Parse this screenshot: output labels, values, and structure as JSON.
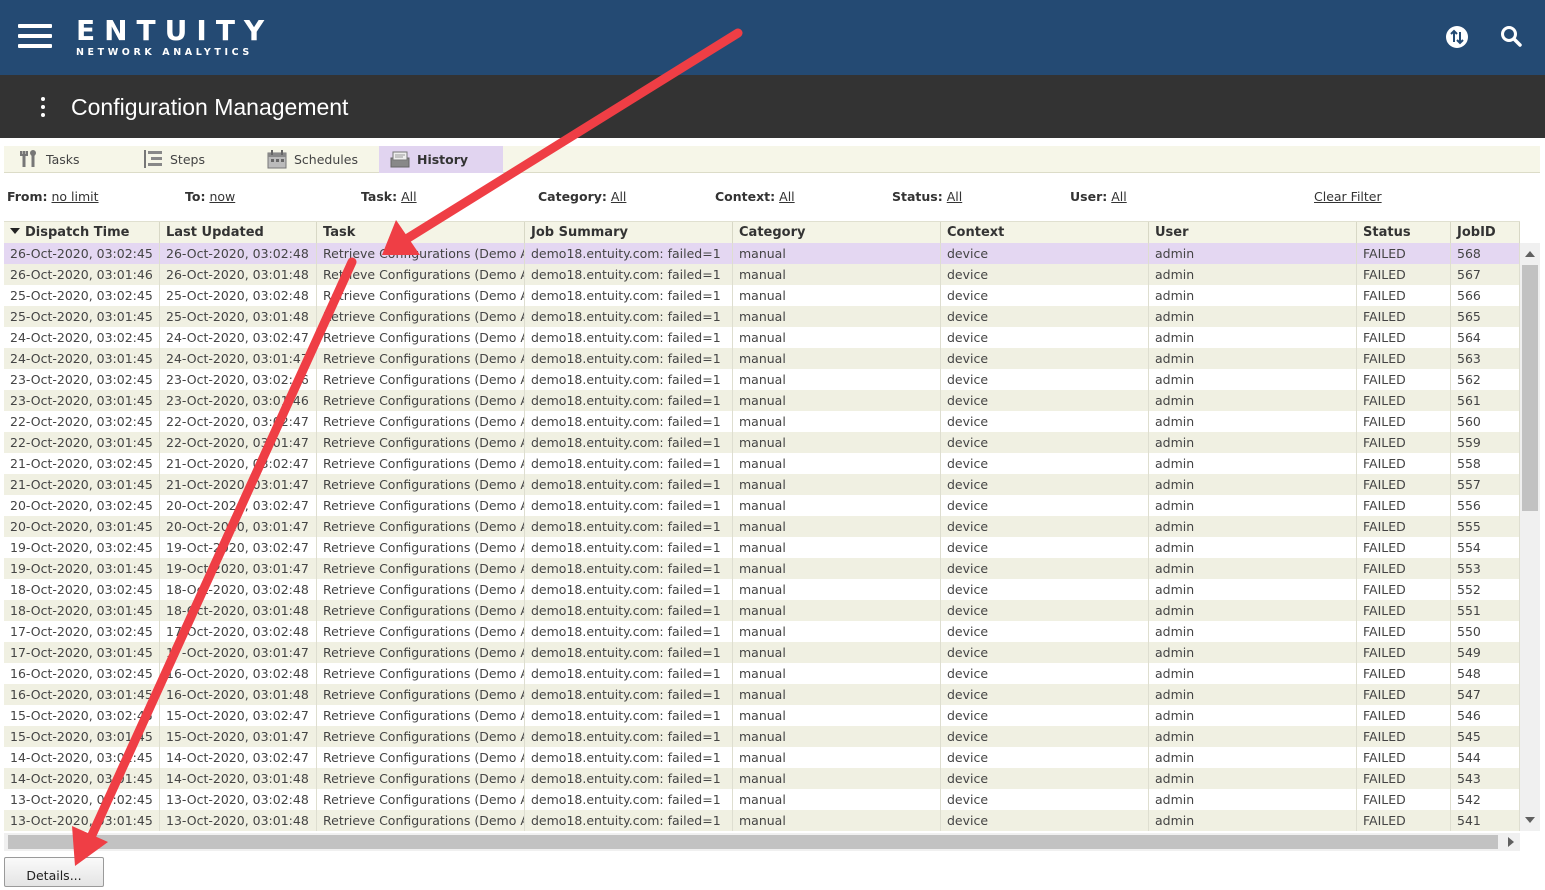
{
  "app": {
    "logo_main": "ENTUITY",
    "logo_sub": "NETWORK ANALYTICS",
    "page_title": "Configuration Management"
  },
  "icons": {
    "menu": "hamburger-menu-icon",
    "sync": "sync-icon",
    "search": "search-icon",
    "more": "kebab-menu-icon"
  },
  "colors": {
    "header": "#244a73",
    "titlebar": "#333333",
    "tab_active": "#e1d4f0",
    "row_selected": "#e4d7f2",
    "row_alt": "#f0f0e2",
    "annotation_arrow": "#ef3e45"
  },
  "tabs": [
    {
      "label": "Tasks",
      "icon": "tools-icon",
      "active": false
    },
    {
      "label": "Steps",
      "icon": "steps-icon",
      "active": false
    },
    {
      "label": "Schedules",
      "icon": "schedule-icon",
      "active": false
    },
    {
      "label": "History",
      "icon": "history-icon",
      "active": true
    }
  ],
  "filters": [
    {
      "label": "From:",
      "value": "no limit"
    },
    {
      "label": "To:",
      "value": "now"
    },
    {
      "label": "Task:",
      "value": "All"
    },
    {
      "label": "Category:",
      "value": "All"
    },
    {
      "label": "Context:",
      "value": "All"
    },
    {
      "label": "Status:",
      "value": "All"
    },
    {
      "label": "User:",
      "value": "All"
    }
  ],
  "clear_filter": "Clear Filter",
  "table": {
    "sorted_column": "Dispatch Time",
    "columns": [
      "Dispatch Time",
      "Last Updated",
      "Task",
      "Job Summary",
      "Category",
      "Context",
      "User",
      "Status",
      "JobID"
    ],
    "rows": [
      [
        "26-Oct-2020, 03:02:45",
        "26-Oct-2020, 03:02:48",
        "Retrieve Configurations (Demo Ap",
        "demo18.entuity.com: failed=1",
        "manual",
        "device",
        "admin",
        "FAILED",
        "568"
      ],
      [
        "26-Oct-2020, 03:01:46",
        "26-Oct-2020, 03:01:48",
        "Retrieve Configurations (Demo Ap",
        "demo18.entuity.com: failed=1",
        "manual",
        "device",
        "admin",
        "FAILED",
        "567"
      ],
      [
        "25-Oct-2020, 03:02:45",
        "25-Oct-2020, 03:02:48",
        "Retrieve Configurations (Demo Ap",
        "demo18.entuity.com: failed=1",
        "manual",
        "device",
        "admin",
        "FAILED",
        "566"
      ],
      [
        "25-Oct-2020, 03:01:45",
        "25-Oct-2020, 03:01:48",
        "Retrieve Configurations (Demo Ap",
        "demo18.entuity.com: failed=1",
        "manual",
        "device",
        "admin",
        "FAILED",
        "565"
      ],
      [
        "24-Oct-2020, 03:02:45",
        "24-Oct-2020, 03:02:47",
        "Retrieve Configurations (Demo Ap",
        "demo18.entuity.com: failed=1",
        "manual",
        "device",
        "admin",
        "FAILED",
        "564"
      ],
      [
        "24-Oct-2020, 03:01:45",
        "24-Oct-2020, 03:01:47",
        "Retrieve Configurations (Demo Ap",
        "demo18.entuity.com: failed=1",
        "manual",
        "device",
        "admin",
        "FAILED",
        "563"
      ],
      [
        "23-Oct-2020, 03:02:45",
        "23-Oct-2020, 03:02:46",
        "Retrieve Configurations (Demo Ap",
        "demo18.entuity.com: failed=1",
        "manual",
        "device",
        "admin",
        "FAILED",
        "562"
      ],
      [
        "23-Oct-2020, 03:01:45",
        "23-Oct-2020, 03:01:46",
        "Retrieve Configurations (Demo Ap",
        "demo18.entuity.com: failed=1",
        "manual",
        "device",
        "admin",
        "FAILED",
        "561"
      ],
      [
        "22-Oct-2020, 03:02:45",
        "22-Oct-2020, 03:02:47",
        "Retrieve Configurations (Demo Ap",
        "demo18.entuity.com: failed=1",
        "manual",
        "device",
        "admin",
        "FAILED",
        "560"
      ],
      [
        "22-Oct-2020, 03:01:45",
        "22-Oct-2020, 03:01:47",
        "Retrieve Configurations (Demo Ap",
        "demo18.entuity.com: failed=1",
        "manual",
        "device",
        "admin",
        "FAILED",
        "559"
      ],
      [
        "21-Oct-2020, 03:02:45",
        "21-Oct-2020, 03:02:47",
        "Retrieve Configurations (Demo Ap",
        "demo18.entuity.com: failed=1",
        "manual",
        "device",
        "admin",
        "FAILED",
        "558"
      ],
      [
        "21-Oct-2020, 03:01:45",
        "21-Oct-2020, 03:01:47",
        "Retrieve Configurations (Demo Ap",
        "demo18.entuity.com: failed=1",
        "manual",
        "device",
        "admin",
        "FAILED",
        "557"
      ],
      [
        "20-Oct-2020, 03:02:45",
        "20-Oct-2020, 03:02:47",
        "Retrieve Configurations (Demo Ap",
        "demo18.entuity.com: failed=1",
        "manual",
        "device",
        "admin",
        "FAILED",
        "556"
      ],
      [
        "20-Oct-2020, 03:01:45",
        "20-Oct-2020, 03:01:47",
        "Retrieve Configurations (Demo Ap",
        "demo18.entuity.com: failed=1",
        "manual",
        "device",
        "admin",
        "FAILED",
        "555"
      ],
      [
        "19-Oct-2020, 03:02:45",
        "19-Oct-2020, 03:02:47",
        "Retrieve Configurations (Demo Ap",
        "demo18.entuity.com: failed=1",
        "manual",
        "device",
        "admin",
        "FAILED",
        "554"
      ],
      [
        "19-Oct-2020, 03:01:45",
        "19-Oct-2020, 03:01:47",
        "Retrieve Configurations (Demo Ap",
        "demo18.entuity.com: failed=1",
        "manual",
        "device",
        "admin",
        "FAILED",
        "553"
      ],
      [
        "18-Oct-2020, 03:02:45",
        "18-Oct-2020, 03:02:48",
        "Retrieve Configurations (Demo Ap",
        "demo18.entuity.com: failed=1",
        "manual",
        "device",
        "admin",
        "FAILED",
        "552"
      ],
      [
        "18-Oct-2020, 03:01:45",
        "18-Oct-2020, 03:01:48",
        "Retrieve Configurations (Demo Ap",
        "demo18.entuity.com: failed=1",
        "manual",
        "device",
        "admin",
        "FAILED",
        "551"
      ],
      [
        "17-Oct-2020, 03:02:45",
        "17-Oct-2020, 03:02:48",
        "Retrieve Configurations (Demo Ap",
        "demo18.entuity.com: failed=1",
        "manual",
        "device",
        "admin",
        "FAILED",
        "550"
      ],
      [
        "17-Oct-2020, 03:01:45",
        "17-Oct-2020, 03:01:47",
        "Retrieve Configurations (Demo Ap",
        "demo18.entuity.com: failed=1",
        "manual",
        "device",
        "admin",
        "FAILED",
        "549"
      ],
      [
        "16-Oct-2020, 03:02:45",
        "16-Oct-2020, 03:02:48",
        "Retrieve Configurations (Demo Ap",
        "demo18.entuity.com: failed=1",
        "manual",
        "device",
        "admin",
        "FAILED",
        "548"
      ],
      [
        "16-Oct-2020, 03:01:45",
        "16-Oct-2020, 03:01:48",
        "Retrieve Configurations (Demo Ap",
        "demo18.entuity.com: failed=1",
        "manual",
        "device",
        "admin",
        "FAILED",
        "547"
      ],
      [
        "15-Oct-2020, 03:02:45",
        "15-Oct-2020, 03:02:47",
        "Retrieve Configurations (Demo Ap",
        "demo18.entuity.com: failed=1",
        "manual",
        "device",
        "admin",
        "FAILED",
        "546"
      ],
      [
        "15-Oct-2020, 03:01:45",
        "15-Oct-2020, 03:01:47",
        "Retrieve Configurations (Demo Ap",
        "demo18.entuity.com: failed=1",
        "manual",
        "device",
        "admin",
        "FAILED",
        "545"
      ],
      [
        "14-Oct-2020, 03:02:45",
        "14-Oct-2020, 03:02:47",
        "Retrieve Configurations (Demo Ap",
        "demo18.entuity.com: failed=1",
        "manual",
        "device",
        "admin",
        "FAILED",
        "544"
      ],
      [
        "14-Oct-2020, 03:01:45",
        "14-Oct-2020, 03:01:48",
        "Retrieve Configurations (Demo Ap",
        "demo18.entuity.com: failed=1",
        "manual",
        "device",
        "admin",
        "FAILED",
        "543"
      ],
      [
        "13-Oct-2020, 03:02:45",
        "13-Oct-2020, 03:02:48",
        "Retrieve Configurations (Demo Ap",
        "demo18.entuity.com: failed=1",
        "manual",
        "device",
        "admin",
        "FAILED",
        "542"
      ],
      [
        "13-Oct-2020, 03:01:45",
        "13-Oct-2020, 03:01:48",
        "Retrieve Configurations (Demo Ap",
        "demo18.entuity.com: failed=1",
        "manual",
        "device",
        "admin",
        "FAILED",
        "541"
      ]
    ]
  },
  "details_button": "Details..."
}
